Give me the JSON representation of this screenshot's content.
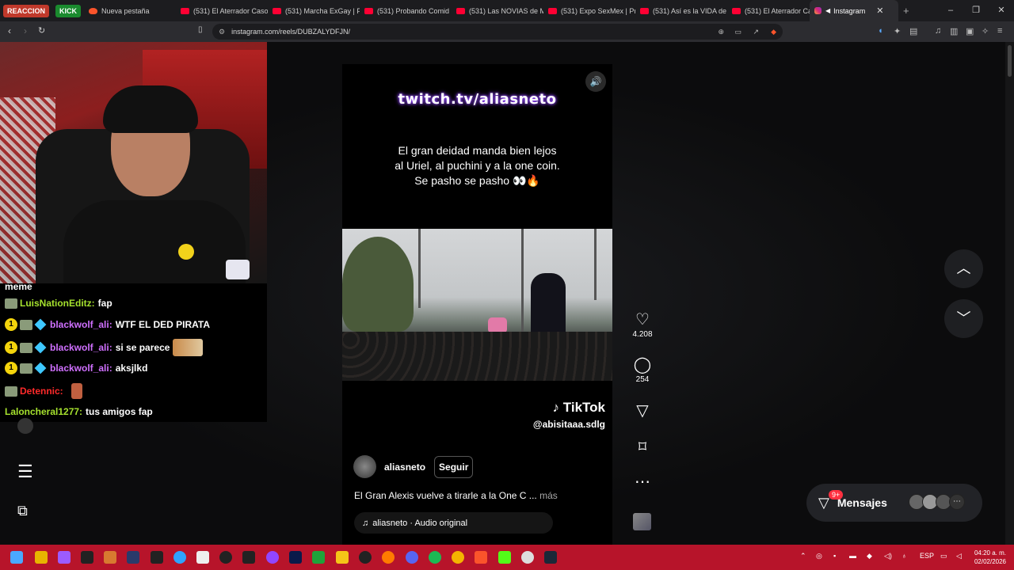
{
  "browser": {
    "pinned_tabs": [
      {
        "label": "REACCION",
        "color": "#c0392b"
      },
      {
        "label": "KICK",
        "color": "#1a8a2e"
      }
    ],
    "tabs": [
      {
        "label": "Nueva pestaña",
        "icon": "brave-icon",
        "color": "#fb542b"
      },
      {
        "label": "(531) El Aterrador Caso",
        "icon": "youtube-icon",
        "color": "#ff0033"
      },
      {
        "label": "(531) Marcha ExGay | P",
        "icon": "youtube-icon",
        "color": "#ff0033"
      },
      {
        "label": "(531) Probando Comid",
        "icon": "youtube-icon",
        "color": "#ff0033"
      },
      {
        "label": "(531) Las NOVIAS de M",
        "icon": "youtube-icon",
        "color": "#ff0033"
      },
      {
        "label": "(531) Expo SexMex | Pr",
        "icon": "youtube-icon",
        "color": "#ff0033"
      },
      {
        "label": "(531) Así es la VIDA de",
        "icon": "youtube-icon",
        "color": "#ff0033"
      },
      {
        "label": "(531) El Aterrador Caso",
        "icon": "youtube-icon",
        "color": "#ff0033"
      }
    ],
    "active_tab": {
      "label": "Instagram",
      "icon": "instagram-icon"
    },
    "url": "instagram.com/reels/DUBZALYDFJN/"
  },
  "chat": {
    "overflow_text": "meme",
    "messages": [
      {
        "user": "LuisNationEditz:",
        "text": "fap",
        "color": "#a6e22e",
        "sub": false
      },
      {
        "user": "blackwolf_ali:",
        "text": "WTF EL DED PIRATA",
        "color": "#d070ff",
        "sub": true
      },
      {
        "user": "blackwolf_ali:",
        "text": "si se parece",
        "color": "#d070ff",
        "sub": true
      },
      {
        "user": "blackwolf_ali:",
        "text": "aksjlkd",
        "color": "#d070ff",
        "sub": true
      },
      {
        "user": "Detennic:",
        "text": "",
        "color": "#ff2a2a",
        "sub": false
      },
      {
        "user": "Laloncheral1277:",
        "text": "tus amigos fap",
        "color": "#a6e22e",
        "sub": false
      }
    ],
    "sub_badge_text": "1"
  },
  "reel": {
    "twitch_banner": "twitch.tv/aliasneto",
    "caption_lines": [
      "El gran deidad manda bien lejos",
      "al Uriel, al puchini y a la one coin.",
      "Se pasho se pasho 👀🔥"
    ],
    "tiktok_logo": "TikTok",
    "tiktok_handle": "@abisitaaa.sdlg",
    "author": "aliasneto",
    "follow_label": "Seguir",
    "description": "El Gran Alexis vuelve a tirarle a la One C ...",
    "more_label": "más",
    "audio": "aliasneto · Audio original"
  },
  "actions": {
    "likes": "4.208",
    "comments": "254"
  },
  "messages_button": {
    "label": "Mensajes",
    "badge": "9+"
  },
  "taskbar": {
    "language": "ESP",
    "time": "04:20 a. m.",
    "date": "02/02/2026"
  }
}
